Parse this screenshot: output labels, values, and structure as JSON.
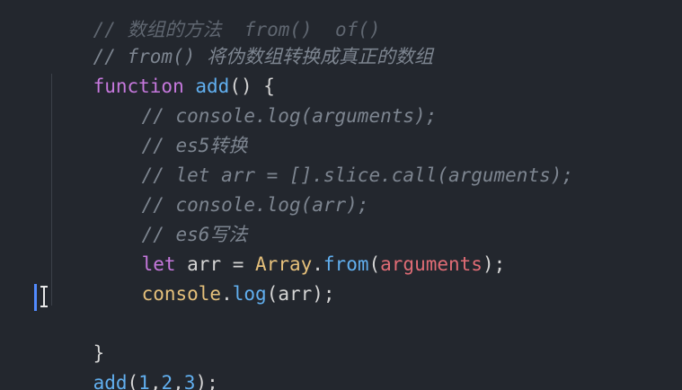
{
  "code": {
    "line0": "// 数组的方法  from()  of()",
    "line1": "// from() 将伪数组转换成真正的数组",
    "line2_kw": "function",
    "line2_fn": "add",
    "line2_rest": "() {",
    "line3": "// console.log(arguments);",
    "line4": "// es5转换",
    "line5": "// let arr = [].slice.call(arguments);",
    "line6": "// console.log(arr);",
    "line7": "// es6写法",
    "line8_let": "let",
    "line8_var": " arr = ",
    "line8_class": "Array",
    "line8_dot": ".",
    "line8_method": "from",
    "line8_open": "(",
    "line8_param": "arguments",
    "line8_close": ");",
    "line9_obj": "console",
    "line9_dot": ".",
    "line9_method": "log",
    "line9_rest": "(arr);",
    "line11": "}",
    "line12_fn": "add",
    "line12_open": "(",
    "line12_n1": "1",
    "line12_c1": ",",
    "line12_n2": "2",
    "line12_c2": ",",
    "line12_n3": "3",
    "line12_close": ");"
  },
  "colors": {
    "background": "#23272e",
    "comment": "#7d8590",
    "keyword": "#c678dd",
    "function": "#61afef",
    "class": "#e5c07b",
    "parameter": "#e06c75",
    "cursor": "#528bff"
  },
  "icons": {
    "cursor": "text-cursor-icon"
  }
}
